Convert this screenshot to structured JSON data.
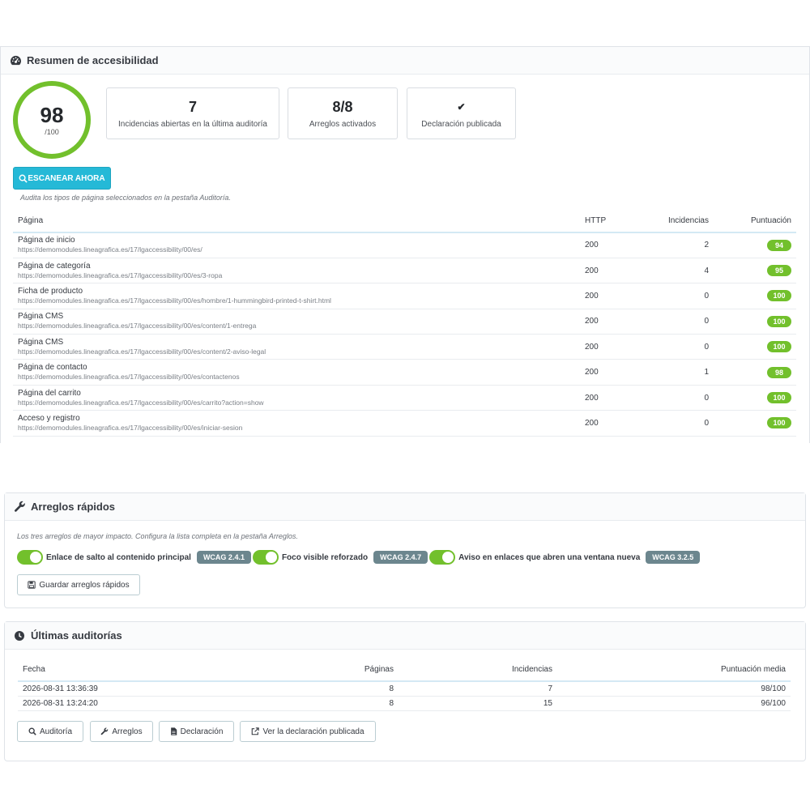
{
  "summary": {
    "title": "Resumen de accesibilidad",
    "score": "98",
    "score_max": "/100",
    "stats": [
      {
        "value": "7",
        "label": "Incidencias abiertas en la última auditoría"
      },
      {
        "value": "8/8",
        "label": "Arreglos activados"
      },
      {
        "value": "✔",
        "label": "Declaración publicada"
      }
    ],
    "scan_button": "ESCANEAR AHORA",
    "hint": "Audita los tipos de página seleccionados en la pestaña Auditoría.",
    "columns": {
      "page": "Página",
      "http": "HTTP",
      "issues": "Incidencias",
      "score": "Puntuación"
    },
    "rows": [
      {
        "name": "Página de inicio",
        "url": "https://demomodules.lineagrafica.es/17/lgaccessibility/00/es/",
        "http": "200",
        "issues": "2",
        "score": "94"
      },
      {
        "name": "Página de categoría",
        "url": "https://demomodules.lineagrafica.es/17/lgaccessibility/00/es/3-ropa",
        "http": "200",
        "issues": "4",
        "score": "95"
      },
      {
        "name": "Ficha de producto",
        "url": "https://demomodules.lineagrafica.es/17/lgaccessibility/00/es/hombre/1-hummingbird-printed-t-shirt.html",
        "http": "200",
        "issues": "0",
        "score": "100"
      },
      {
        "name": "Página CMS",
        "url": "https://demomodules.lineagrafica.es/17/lgaccessibility/00/es/content/1-entrega",
        "http": "200",
        "issues": "0",
        "score": "100"
      },
      {
        "name": "Página CMS",
        "url": "https://demomodules.lineagrafica.es/17/lgaccessibility/00/es/content/2-aviso-legal",
        "http": "200",
        "issues": "0",
        "score": "100"
      },
      {
        "name": "Página de contacto",
        "url": "https://demomodules.lineagrafica.es/17/lgaccessibility/00/es/contactenos",
        "http": "200",
        "issues": "1",
        "score": "98"
      },
      {
        "name": "Página del carrito",
        "url": "https://demomodules.lineagrafica.es/17/lgaccessibility/00/es/carrito?action=show",
        "http": "200",
        "issues": "0",
        "score": "100"
      },
      {
        "name": "Acceso y registro",
        "url": "https://demomodules.lineagrafica.es/17/lgaccessibility/00/es/iniciar-sesion",
        "http": "200",
        "issues": "0",
        "score": "100"
      }
    ]
  },
  "quickfixes": {
    "title": "Arreglos rápidos",
    "hint": "Los tres arreglos de mayor impacto. Configura la lista completa en la pestaña Arreglos.",
    "items": [
      {
        "label": "Enlace de salto al contenido principal",
        "wcag": "WCAG 2.4.1",
        "enabled": true
      },
      {
        "label": "Foco visible reforzado",
        "wcag": "WCAG 2.4.7",
        "enabled": true
      },
      {
        "label": "Aviso en enlaces que abren una ventana nueva",
        "wcag": "WCAG 3.2.5",
        "enabled": true
      }
    ],
    "save_button": "Guardar arreglos rápidos"
  },
  "audits": {
    "title": "Últimas auditorías",
    "columns": {
      "date": "Fecha",
      "pages": "Páginas",
      "issues": "Incidencias",
      "avg": "Puntuación media"
    },
    "rows": [
      {
        "date": "2026-08-31 13:36:39",
        "pages": "8",
        "issues": "7",
        "avg": "98/100"
      },
      {
        "date": "2026-08-31 13:24:20",
        "pages": "8",
        "issues": "15",
        "avg": "96/100"
      }
    ],
    "buttons": {
      "audit": "Auditoría",
      "fixes": "Arreglos",
      "declaration": "Declaración",
      "view_declaration": "Ver la declaración publicada"
    }
  },
  "colors": {
    "accent": "#25b9d7",
    "success": "#72c02c",
    "badge_gray": "#6c868e"
  }
}
